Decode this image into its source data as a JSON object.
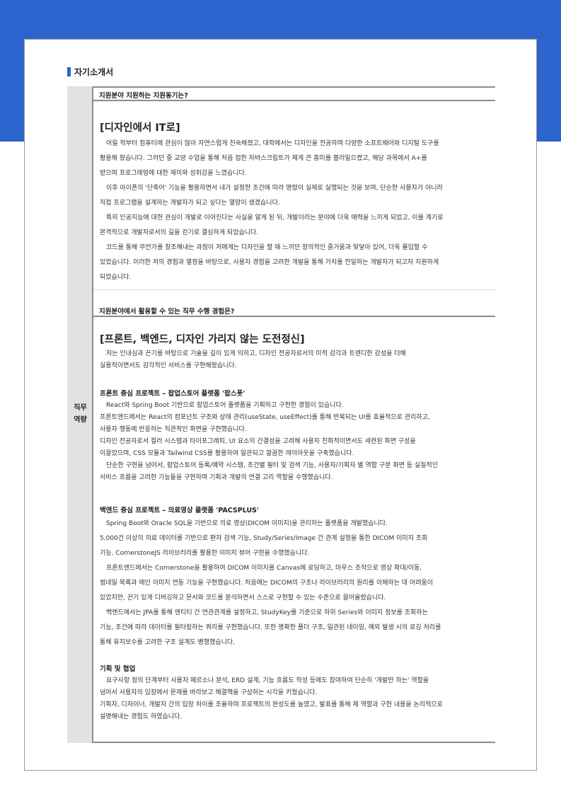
{
  "section_title": "자기소개서",
  "side_label": [
    "직무",
    "역량"
  ],
  "q1": {
    "question": "지원분야 지원하는 지원동기는?",
    "title": "[디자인에서 IT로]",
    "lines": [
      "어릴 적부터 컴퓨터에 관심이 많아 자연스럽게 친숙해졌고, 대학에서는 디자인을 전공하며 다양한 소프트웨어와 디지털 도구를",
      "활용해 왔습니다. 그러던 중 교양 수업을 통해 처음 접한 자바스크립트가 제게 큰 흥미를 불러일으켰고, 해당 과목에서 A+를",
      "받으며 프로그래밍에 대한 재미와 성취감을 느꼈습니다.",
      "이후 아이폰의 '단축어' 기능을 활용하면서 내가 설정한 조건에 따라 명령이 실제로 실행되는 것을 보며, 단순한 사용자가 아니라",
      "직접 프로그램을 설계하는 개발자가 되고 싶다는 열망이 생겼습니다.",
      "특히 인공지능에 대한 관심이 개발로 이어진다는 사실을 알게 된 뒤, 개발이라는 분야에 더욱 매력을 느끼게 되었고, 이를 계기로",
      "본격적으로 개발자로서의 길을 걷기로 결심하게 되었습니다.",
      "코드를 통해 무언가를 창조해내는 과정이 저에게는 디자인을 할 때 느끼던 창의적인 즐거움과 맞닿아 있어, 더욱 몰입할 수",
      "있었습니다. 이러한 저의 경험과 열정을 바탕으로, 사용자 경험을 고려한 개발을 통해 가치를 전달하는 개발자가 되고자 지원하게",
      "되었습니다."
    ]
  },
  "q2": {
    "question": "지원분야에서 활용할 수 있는 직무 수행 경험은?",
    "title": "[프론트, 백엔드, 디자인 가리지 않는 도전정신]",
    "intro": [
      "저는 인내심과 끈기를 바탕으로 기술을 깊이 있게 익히고, 디자인 전공자로서의 미적 감각과 트렌디한 감성을 더해",
      "실용적이면서도 감각적인 서비스를 구현해왔습니다."
    ],
    "front_title": "프론트 중심 프로젝트 – 팝업스토어 플랫폼 '팝스폿'",
    "front_lines": [
      "React와 Spring Boot 기반으로 팝업스토어 플랫폼을 기획하고 구현한 경험이 있습니다.",
      "프론트엔드에서는 React의 컴포넌트 구조와 상태 관리(useState, useEffect)를 통해 반복되는 UI를 효율적으로 관리하고,",
      "사용자 행동에 반응하는 직관적인 화면을 구현했습니다.",
      "디자인 전공자로서 컬러 시스템과 타이포그래피, UI 요소의 간결성을 고려해 사용자 친화적이면서도 세련된 화면 구성을",
      "이끌었으며, CSS 모듈과 Tailwind CSS를 활용하여 일관되고 깔끔한 레이아웃을 구축했습니다.",
      "단순한 구현을 넘어서, 팝업스토어 등록/예약 시스템, 조건별 필터 및 검색 기능, 사용자/기획자 별 역할 구분 화면 등 실질적인",
      "서비스 흐름을 고려한 기능들을 구현하며 기획과 개발의 연결 고리 역할을 수행했습니다."
    ],
    "back_title": "백엔드 중심 프로젝트 – 의료영상 플랫폼 'PACSPLUS'",
    "back_lines": [
      "Spring Boot와 Oracle SQL을 기반으로 의료 영상(DICOM 이미지)을 관리하는 플랫폼을 개발했습니다.",
      "5,000건 이상의 의료 데이터를 기반으로 환자 검색 기능, Study/Series/Image 간 관계 설정을 통한 DICOM 이미지 조회",
      "기능, CornerstoneJS 라이브러리를 활용한 이미지 뷰어 구현을 수행했습니다.",
      "프론트엔드에서는 Cornerstone을 활용하여 DICOM 이미지를 Canvas에 로딩하고, 마우스 조작으로 영상 확대/이동,",
      "썸네일 목록과 메인 이미지 연동 기능을 구현했습니다. 처음에는 DICOM의 구조나 라이브러리의 원리를 이해하는 데 어려움이",
      "있었지만, 끈기 있게 디버깅하고 문서와 코드를 분석하면서 스스로 구현할 수 있는 수준으로 끌어올렸습니다.",
      "백엔드에서는 JPA를 통해 엔티티 간 연관관계를 설정하고, StudyKey를 기준으로 하위 Series와 이미지 정보를 조회하는",
      "기능, 조건에 따라 데이터를 필터링하는 쿼리를 구현했습니다. 또한 명확한 폴더 구조, 일관된 네이밍, 예외 발생 시의 로깅 처리를",
      "통해 유지보수를 고려한 구조 설계도 병행했습니다."
    ],
    "plan_title": "기획 및 협업",
    "plan_lines": [
      "요구사항 정의 단계부터 사용자 페르소나 분석, ERD 설계, 기능 흐름도 작성 등에도 참여하여 단순히 '개발만 하는' 역할을",
      "넘어서 사용자의 입장에서 문제를 바라보고 해결책을 구상하는 시각을 키웠습니다.",
      "기획자, 디자이너, 개발자 간의 입장 차이를 조율하며 프로젝트의 완성도를 높였고, 발표를 통해 제 역할과 구현 내용을 논리적으로",
      "설명해내는 경험도 하였습니다."
    ]
  }
}
